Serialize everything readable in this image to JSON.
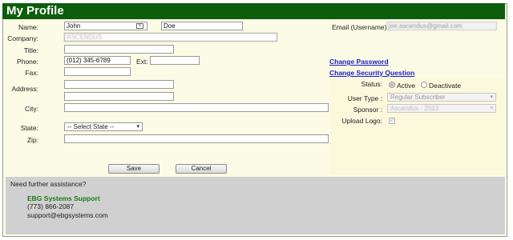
{
  "title": "My Profile",
  "form": {
    "name_label": "Name:",
    "first_name": "John",
    "last_name": "Doe",
    "company_label": "Company:",
    "company_value": "ASCENDUS",
    "title_label": "Title:",
    "phone_label": "Phone:",
    "phone_value": "(012) 345-6789",
    "ext_label": "Ext:",
    "fax_label": "Fax:",
    "address_label": "Address:",
    "city_label": "City:",
    "state_label": "State:",
    "state_value": "-- Select State --",
    "zip_label": "Zip:",
    "save_label": "Save",
    "cancel_label": "Cancel"
  },
  "account": {
    "email_label": "Email (Username):",
    "email_value": "joe.ascendus@gmail.com",
    "change_password": "Change Password",
    "change_security_question": "Change Security Question",
    "status_label": "Status:",
    "active_label": "Active",
    "deactivate_label": "Deactivate",
    "user_type_label": "User Type :",
    "user_type_value": "Regular Subscriber",
    "sponsor_label": "Sponsor :",
    "sponsor_value": "Ascendus - 2013",
    "upload_logo_label": "Upload Logo:"
  },
  "footer": {
    "assist_text": "Need further assistance?",
    "support_name": "EBG Systems Support",
    "support_phone": "(773) 866-2087",
    "support_email": "support@ebgsystems.com"
  },
  "colors": {
    "title_bar": "#0c5e0c",
    "link": "#1a1ac8",
    "support_name": "#1b7a1b"
  },
  "icons": {
    "contact_card": "contact-card-icon",
    "chevron": "chevron-down-icon"
  }
}
